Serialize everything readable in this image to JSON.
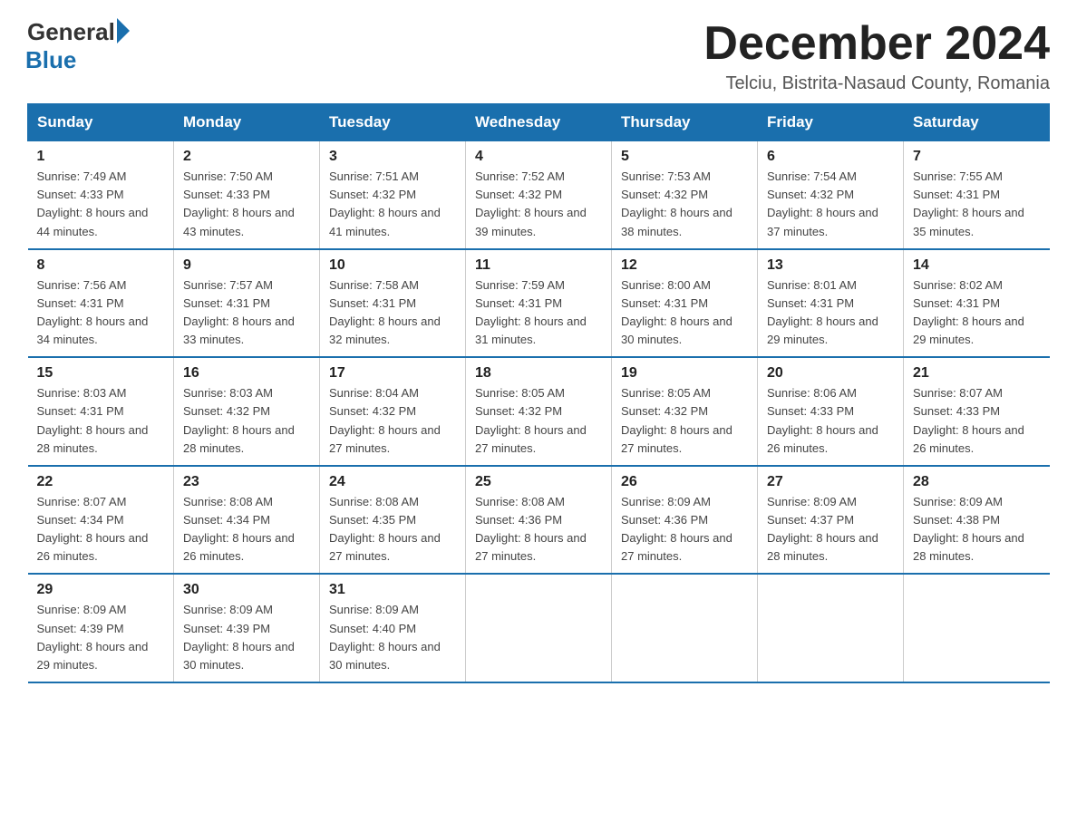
{
  "header": {
    "logo_general": "General",
    "logo_blue": "Blue",
    "title": "December 2024",
    "subtitle": "Telciu, Bistrita-Nasaud County, Romania"
  },
  "weekdays": [
    "Sunday",
    "Monday",
    "Tuesday",
    "Wednesday",
    "Thursday",
    "Friday",
    "Saturday"
  ],
  "weeks": [
    [
      {
        "day": "1",
        "sunrise": "7:49 AM",
        "sunset": "4:33 PM",
        "daylight": "8 hours and 44 minutes."
      },
      {
        "day": "2",
        "sunrise": "7:50 AM",
        "sunset": "4:33 PM",
        "daylight": "8 hours and 43 minutes."
      },
      {
        "day": "3",
        "sunrise": "7:51 AM",
        "sunset": "4:32 PM",
        "daylight": "8 hours and 41 minutes."
      },
      {
        "day": "4",
        "sunrise": "7:52 AM",
        "sunset": "4:32 PM",
        "daylight": "8 hours and 39 minutes."
      },
      {
        "day": "5",
        "sunrise": "7:53 AM",
        "sunset": "4:32 PM",
        "daylight": "8 hours and 38 minutes."
      },
      {
        "day": "6",
        "sunrise": "7:54 AM",
        "sunset": "4:32 PM",
        "daylight": "8 hours and 37 minutes."
      },
      {
        "day": "7",
        "sunrise": "7:55 AM",
        "sunset": "4:31 PM",
        "daylight": "8 hours and 35 minutes."
      }
    ],
    [
      {
        "day": "8",
        "sunrise": "7:56 AM",
        "sunset": "4:31 PM",
        "daylight": "8 hours and 34 minutes."
      },
      {
        "day": "9",
        "sunrise": "7:57 AM",
        "sunset": "4:31 PM",
        "daylight": "8 hours and 33 minutes."
      },
      {
        "day": "10",
        "sunrise": "7:58 AM",
        "sunset": "4:31 PM",
        "daylight": "8 hours and 32 minutes."
      },
      {
        "day": "11",
        "sunrise": "7:59 AM",
        "sunset": "4:31 PM",
        "daylight": "8 hours and 31 minutes."
      },
      {
        "day": "12",
        "sunrise": "8:00 AM",
        "sunset": "4:31 PM",
        "daylight": "8 hours and 30 minutes."
      },
      {
        "day": "13",
        "sunrise": "8:01 AM",
        "sunset": "4:31 PM",
        "daylight": "8 hours and 29 minutes."
      },
      {
        "day": "14",
        "sunrise": "8:02 AM",
        "sunset": "4:31 PM",
        "daylight": "8 hours and 29 minutes."
      }
    ],
    [
      {
        "day": "15",
        "sunrise": "8:03 AM",
        "sunset": "4:31 PM",
        "daylight": "8 hours and 28 minutes."
      },
      {
        "day": "16",
        "sunrise": "8:03 AM",
        "sunset": "4:32 PM",
        "daylight": "8 hours and 28 minutes."
      },
      {
        "day": "17",
        "sunrise": "8:04 AM",
        "sunset": "4:32 PM",
        "daylight": "8 hours and 27 minutes."
      },
      {
        "day": "18",
        "sunrise": "8:05 AM",
        "sunset": "4:32 PM",
        "daylight": "8 hours and 27 minutes."
      },
      {
        "day": "19",
        "sunrise": "8:05 AM",
        "sunset": "4:32 PM",
        "daylight": "8 hours and 27 minutes."
      },
      {
        "day": "20",
        "sunrise": "8:06 AM",
        "sunset": "4:33 PM",
        "daylight": "8 hours and 26 minutes."
      },
      {
        "day": "21",
        "sunrise": "8:07 AM",
        "sunset": "4:33 PM",
        "daylight": "8 hours and 26 minutes."
      }
    ],
    [
      {
        "day": "22",
        "sunrise": "8:07 AM",
        "sunset": "4:34 PM",
        "daylight": "8 hours and 26 minutes."
      },
      {
        "day": "23",
        "sunrise": "8:08 AM",
        "sunset": "4:34 PM",
        "daylight": "8 hours and 26 minutes."
      },
      {
        "day": "24",
        "sunrise": "8:08 AM",
        "sunset": "4:35 PM",
        "daylight": "8 hours and 27 minutes."
      },
      {
        "day": "25",
        "sunrise": "8:08 AM",
        "sunset": "4:36 PM",
        "daylight": "8 hours and 27 minutes."
      },
      {
        "day": "26",
        "sunrise": "8:09 AM",
        "sunset": "4:36 PM",
        "daylight": "8 hours and 27 minutes."
      },
      {
        "day": "27",
        "sunrise": "8:09 AM",
        "sunset": "4:37 PM",
        "daylight": "8 hours and 28 minutes."
      },
      {
        "day": "28",
        "sunrise": "8:09 AM",
        "sunset": "4:38 PM",
        "daylight": "8 hours and 28 minutes."
      }
    ],
    [
      {
        "day": "29",
        "sunrise": "8:09 AM",
        "sunset": "4:39 PM",
        "daylight": "8 hours and 29 minutes."
      },
      {
        "day": "30",
        "sunrise": "8:09 AM",
        "sunset": "4:39 PM",
        "daylight": "8 hours and 30 minutes."
      },
      {
        "day": "31",
        "sunrise": "8:09 AM",
        "sunset": "4:40 PM",
        "daylight": "8 hours and 30 minutes."
      },
      null,
      null,
      null,
      null
    ]
  ]
}
